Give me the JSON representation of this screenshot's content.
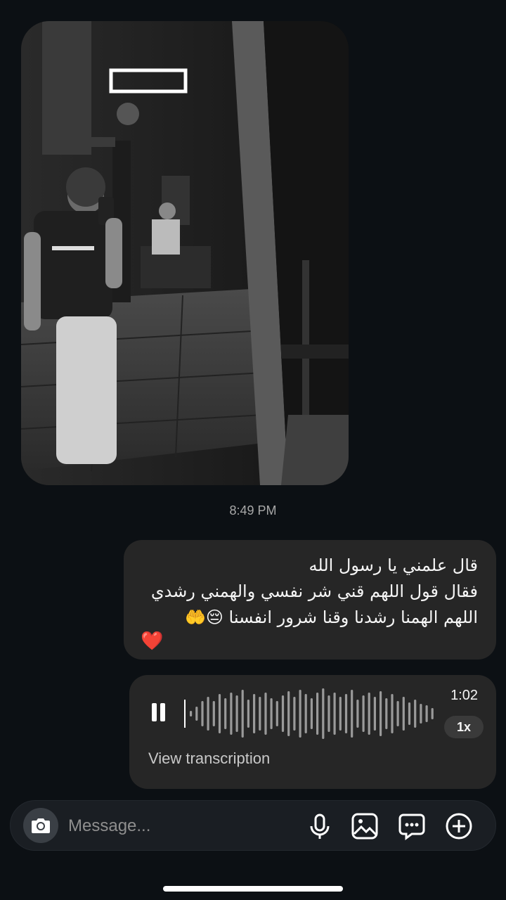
{
  "thread": {
    "photo": {
      "description_icon": "gym-photo"
    },
    "timestamp": "8:49 PM",
    "text_message": {
      "line1": "قال علمني يا رسول الله",
      "line2": "فقال قول اللهم قني شر نفسي والهمني رشدي",
      "line3": "اللهم الهمنا رشدنا وقنا شرور انفسنا",
      "line3_emoji": "😔🤲",
      "line4": "❤️"
    },
    "voice_message": {
      "duration": "1:02",
      "speed": "1x",
      "transcription_link": "View transcription",
      "state": "playing",
      "waveform": [
        4,
        10,
        18,
        24,
        18,
        28,
        22,
        30,
        26,
        34,
        20,
        28,
        24,
        30,
        22,
        18,
        26,
        32,
        24,
        34,
        28,
        22,
        30,
        36,
        26,
        30,
        24,
        28,
        34,
        20,
        26,
        30,
        24,
        32,
        22,
        28,
        18,
        24,
        16,
        20,
        14,
        12,
        8,
        4
      ]
    }
  },
  "composer": {
    "placeholder": "Message...",
    "icons": [
      "camera-icon",
      "microphone-icon",
      "gallery-icon",
      "sticker-icon",
      "plus-icon"
    ]
  },
  "colors": {
    "background": "#0c1014",
    "bubble": "#262626",
    "heart": "#e02a35",
    "composer": "#1a1e23"
  }
}
